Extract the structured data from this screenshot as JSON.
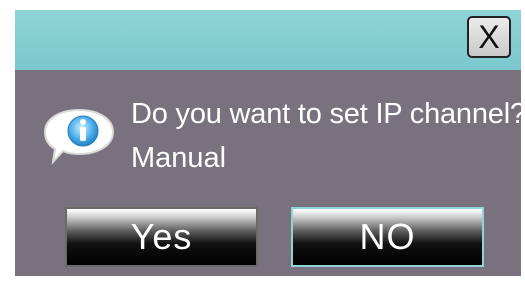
{
  "dialog": {
    "close_label": "X",
    "message_line1": "Do you want to set IP channel?",
    "message_line2": "Manual",
    "yes_label": "Yes",
    "no_label": "NO",
    "icon": "info-bubble-icon",
    "colors": {
      "titlebar": "#8fd4d7",
      "body": "#7a717e",
      "focus_border": "#8fd4d7",
      "text": "#ffffff"
    }
  }
}
